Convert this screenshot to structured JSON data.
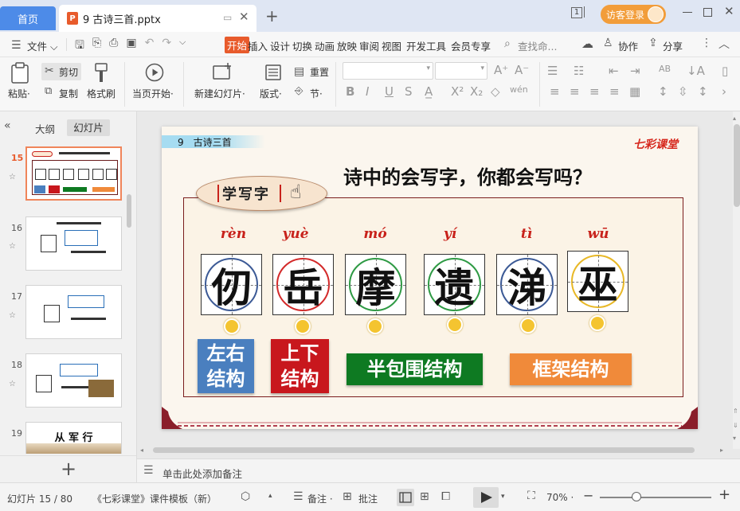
{
  "titlebar": {
    "home_tab": "首页",
    "doc_tab": "9 古诗三首.pptx",
    "doc_icon_letter": "P",
    "counter": "1",
    "login": "访客登录"
  },
  "menubar": {
    "file": "文件",
    "items": [
      "开始",
      "插入",
      "设计",
      "切换",
      "动画",
      "放映",
      "审阅",
      "视图",
      "开发工具",
      "会员专享"
    ],
    "search_placeholder": "查找命...",
    "collab": "协作",
    "share": "分享"
  },
  "ribbon": {
    "paste": "粘贴",
    "cut": "剪切",
    "copy": "复制",
    "format_painter": "格式刷",
    "start_from_current": "当页开始",
    "new_slide": "新建幻灯片",
    "layout": "版式",
    "reset": "重置",
    "section": "节"
  },
  "left_panel": {
    "tab_outline": "大纲",
    "tab_slides": "幻灯片",
    "slides": [
      {
        "num": "15",
        "selected": true
      },
      {
        "num": "16"
      },
      {
        "num": "17"
      },
      {
        "num": "18"
      },
      {
        "num": "19",
        "title": "从 军 行"
      }
    ],
    "add_button": "+"
  },
  "slide": {
    "header_tag": "9　古诗三首",
    "logo": "七彩课堂",
    "badge": "学写字",
    "title": "诗中的会写字，你都会写吗？",
    "chars": [
      {
        "pinyin": "rèn",
        "hanzi": "仞",
        "ring": "#3c5a96"
      },
      {
        "pinyin": "yuè",
        "hanzi": "岳",
        "ring": "#d32a2a"
      },
      {
        "pinyin": "mó",
        "hanzi": "摩",
        "ring": "#2e9a44"
      },
      {
        "pinyin": "yí",
        "hanzi": "遗",
        "ring": "#2e9a44"
      },
      {
        "pinyin": "tì",
        "hanzi": "涕",
        "ring": "#3c5a96"
      },
      {
        "pinyin": "wū",
        "hanzi": "巫",
        "ring": "#e8b826"
      }
    ],
    "structures": [
      {
        "label": "左右\n结构",
        "color": "#4a7fbf"
      },
      {
        "label": "上下\n结构",
        "color": "#c8171d"
      },
      {
        "label": "半包围结构",
        "color": "#0e7a22"
      },
      {
        "label": "框架结构",
        "color": "#f08a3a"
      }
    ]
  },
  "notes": {
    "placeholder": "单击此处添加备注"
  },
  "statusbar": {
    "slide_count": "幻灯片 15 / 80",
    "template": "《七彩课堂》课件模板（新）",
    "notes_btn": "备注",
    "comment_btn": "批注",
    "zoom": "70%"
  }
}
